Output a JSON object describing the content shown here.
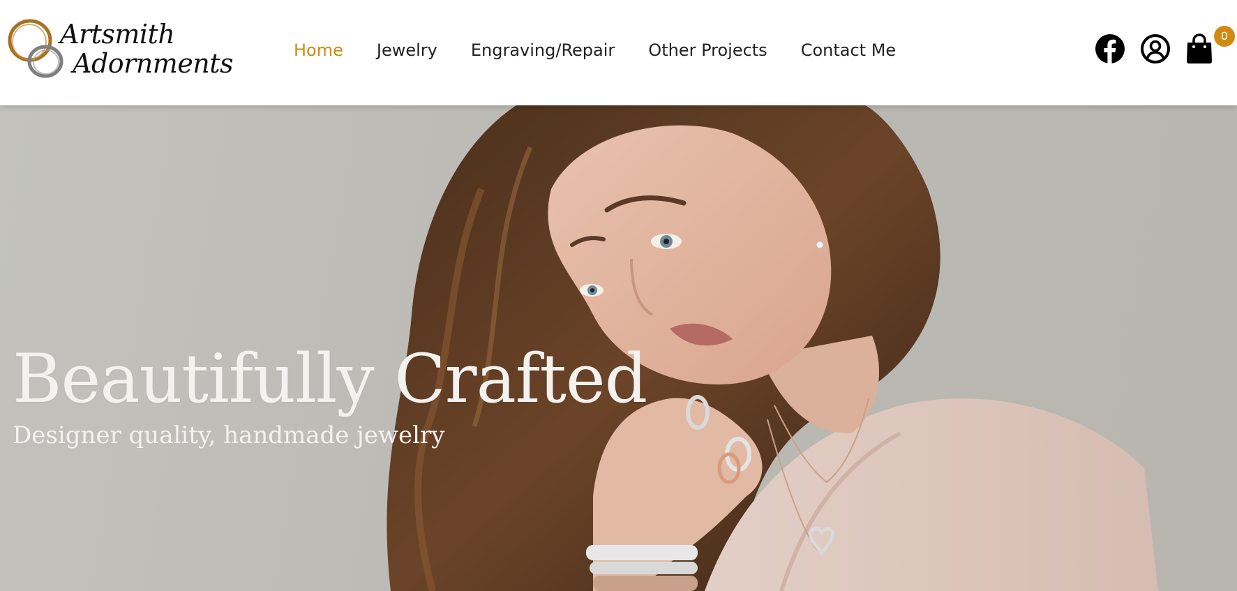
{
  "brand": {
    "name_line1": "Artsmith",
    "name_line2": "Adornments"
  },
  "nav": {
    "items": [
      {
        "label": "Home",
        "active": true
      },
      {
        "label": "Jewelry",
        "active": false
      },
      {
        "label": "Engraving/Repair",
        "active": false
      },
      {
        "label": "Other Projects",
        "active": false
      },
      {
        "label": "Contact Me",
        "active": false
      }
    ]
  },
  "header_icons": {
    "facebook": "facebook-icon",
    "account": "account-icon",
    "cart": "shopping-bag-icon",
    "cart_count": "0"
  },
  "hero": {
    "title": "Beautifully Crafted",
    "subtitle": "Designer quality, handmade jewelry",
    "image": "woman-wearing-rings-necklace-bracelets-photo"
  },
  "colors": {
    "accent": "#d08a14",
    "nav_text": "#222222",
    "hero_text": "#f4f2ef",
    "hero_background": "#bdbbb5"
  }
}
